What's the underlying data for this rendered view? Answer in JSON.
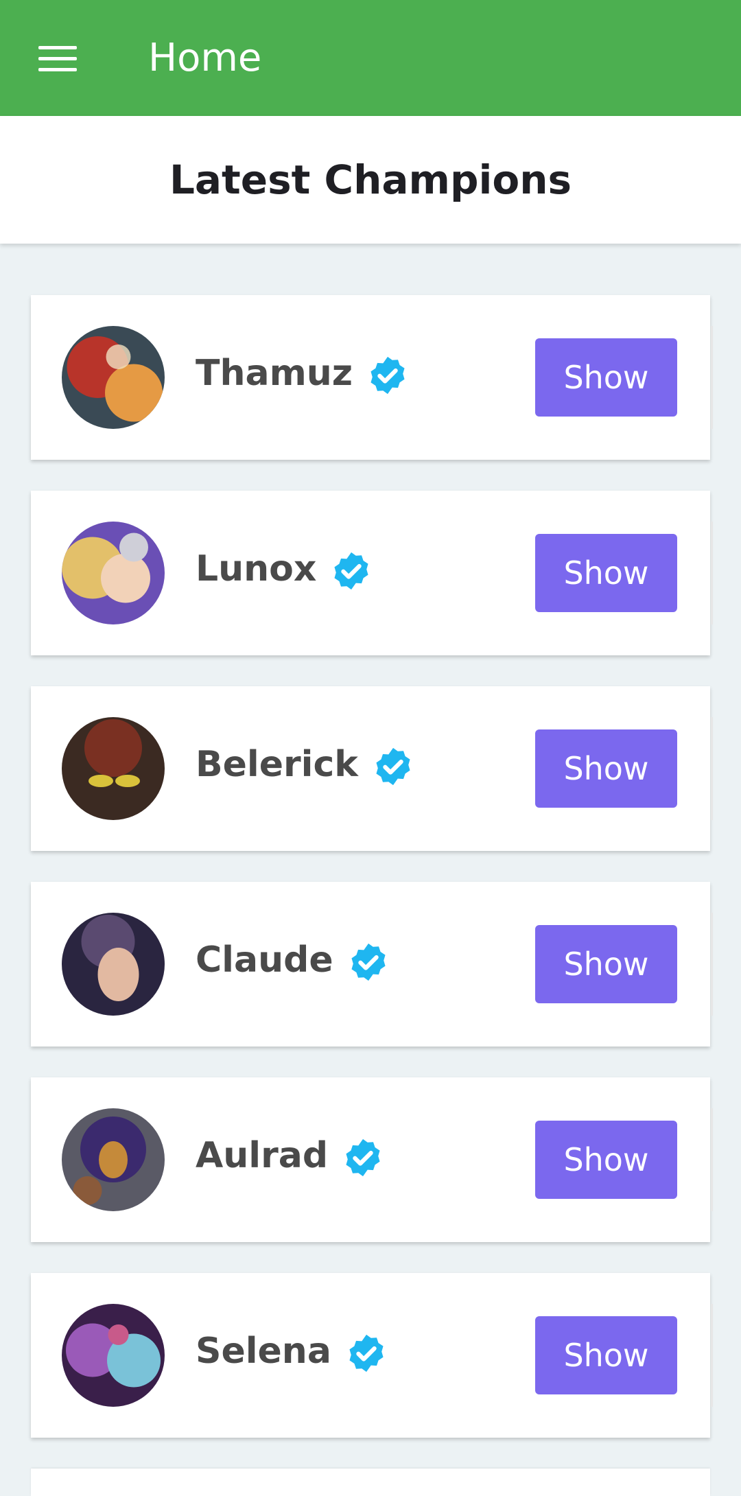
{
  "appbar": {
    "title": "Home",
    "menu_icon": "hamburger-menu-icon",
    "color": "#4caf50"
  },
  "page": {
    "title": "Latest Champions"
  },
  "champions": [
    {
      "name": "Thamuz",
      "button": "Show",
      "verified_icon": "verified-badge-icon",
      "avatar_colors": [
        "#b8342a",
        "#3a4a55",
        "#e59a44"
      ]
    },
    {
      "name": "Lunox",
      "button": "Show",
      "verified_icon": "verified-badge-icon",
      "avatar_colors": [
        "#6a4fb5",
        "#e3c06a",
        "#f2d2b8"
      ]
    },
    {
      "name": "Belerick",
      "button": "Show",
      "verified_icon": "verified-badge-icon",
      "avatar_colors": [
        "#3b2a22",
        "#d9c23b",
        "#7a3022"
      ]
    },
    {
      "name": "Claude",
      "button": "Show",
      "verified_icon": "verified-badge-icon",
      "avatar_colors": [
        "#2a2540",
        "#5a4a70",
        "#e2b9a1"
      ]
    },
    {
      "name": "Aulrad",
      "button": "Show",
      "verified_icon": "verified-badge-icon",
      "avatar_colors": [
        "#3b2a6e",
        "#c58a3a",
        "#5a5a66"
      ]
    },
    {
      "name": "Selena",
      "button": "Show",
      "verified_icon": "verified-badge-icon",
      "avatar_colors": [
        "#3a1f4a",
        "#9a5ab8",
        "#7ac2d8"
      ]
    }
  ],
  "colors": {
    "button": "#7b68ee",
    "verified": "#1fb6f0",
    "background": "#ecf2f4"
  }
}
